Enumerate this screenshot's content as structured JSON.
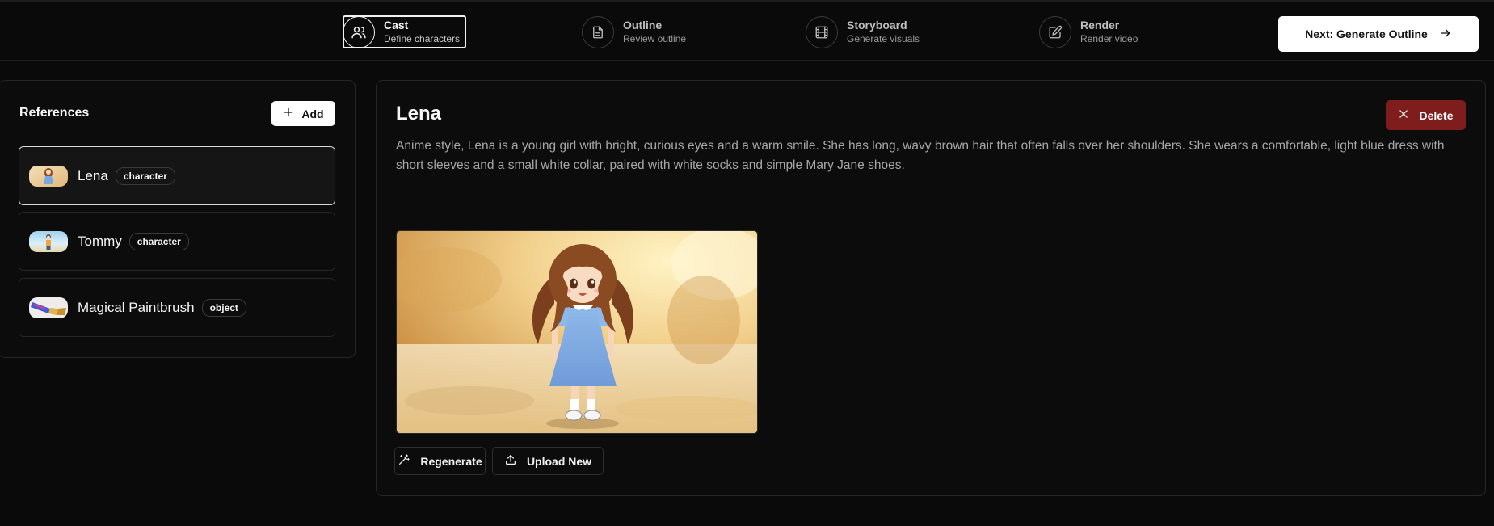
{
  "stepper": {
    "steps": [
      {
        "title": "Cast",
        "subtitle": "Define characters",
        "icon": "users-icon",
        "active": true
      },
      {
        "title": "Outline",
        "subtitle": "Review outline",
        "icon": "document-icon",
        "active": false
      },
      {
        "title": "Storyboard",
        "subtitle": "Generate visuals",
        "icon": "film-icon",
        "active": false
      },
      {
        "title": "Render",
        "subtitle": "Render video",
        "icon": "edit-icon",
        "active": false
      }
    ],
    "next_label": "Next: Generate Outline"
  },
  "references": {
    "title": "References",
    "add_label": "Add",
    "items": [
      {
        "name": "Lena",
        "type": "character",
        "selected": true
      },
      {
        "name": "Tommy",
        "type": "character",
        "selected": false
      },
      {
        "name": "Magical Paintbrush",
        "type": "object",
        "selected": false
      }
    ]
  },
  "detail": {
    "name": "Lena",
    "delete_label": "Delete",
    "description": "Anime style, Lena is a young girl with bright, curious eyes and a warm smile. She has long, wavy brown hair that often falls over her shoulders. She wears a comfortable, light blue dress with short sleeves and a small white collar, paired with white socks and simple Mary Jane shoes.",
    "regenerate_label": "Regenerate",
    "upload_label": "Upload New"
  },
  "colors": {
    "background": "#0a0a0a",
    "delete": "#7f1d1d",
    "primary_button": "#ffffff",
    "border": "#262626"
  }
}
